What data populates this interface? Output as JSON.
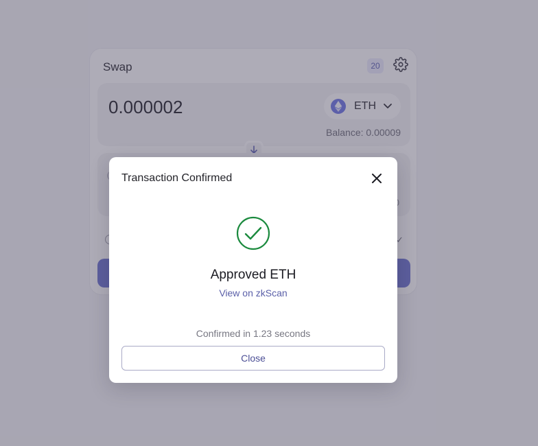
{
  "swap": {
    "title": "Swap",
    "slippage_badge": "20",
    "from": {
      "amount": "0.000002",
      "token": "ETH",
      "balance": "Balance: 0.00009"
    },
    "to": {
      "balance_partial": "0"
    }
  },
  "modal": {
    "title": "Transaction Confirmed",
    "status": "Approved ETH",
    "link_text": "View on zkScan",
    "confirm_time": "Confirmed in 1.23 seconds",
    "close_label": "Close"
  },
  "colors": {
    "accent": "#5a5fa8",
    "success": "#1b8a3e",
    "token_eth": "#6a72e0"
  },
  "icons": {
    "settings": "gear-icon",
    "close": "close-icon",
    "success": "check-circle-icon",
    "swap_direction": "arrow-down-icon",
    "token": "eth-icon",
    "dropdown": "chevron-down-icon"
  }
}
